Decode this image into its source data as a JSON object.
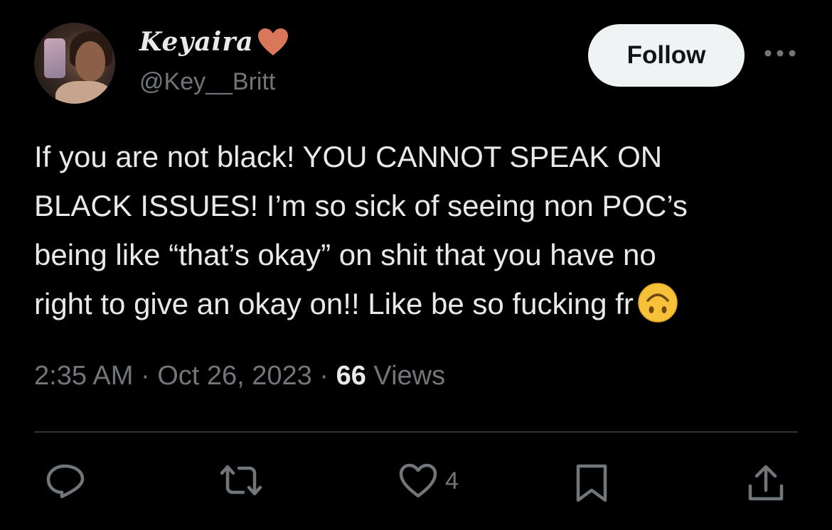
{
  "user": {
    "display_name": "Keyaira",
    "name_emoji": "orange-heart-icon",
    "handle": "@Key__Britt"
  },
  "follow_button": {
    "label": "Follow"
  },
  "tweet": {
    "text": "If you are not black! YOU CANNOT SPEAK ON\nBLACK ISSUES! I’m so sick of seeing non POC’s\nbeing like “that’s okay” on shit that you have no\nright to give an okay on!! Like be so fucking fr",
    "trailing_emoji": "upside-down-face-icon"
  },
  "meta": {
    "time": "2:35 AM",
    "separator": " · ",
    "date": "Oct 26, 2023",
    "views_count": "66",
    "views_label": "Views"
  },
  "actions": {
    "like_count": "4"
  },
  "colors": {
    "background": "#000000",
    "text": "#e7e9ea",
    "muted": "#71767b",
    "heart": "#d9775a",
    "emoji": "#f7c23a"
  }
}
